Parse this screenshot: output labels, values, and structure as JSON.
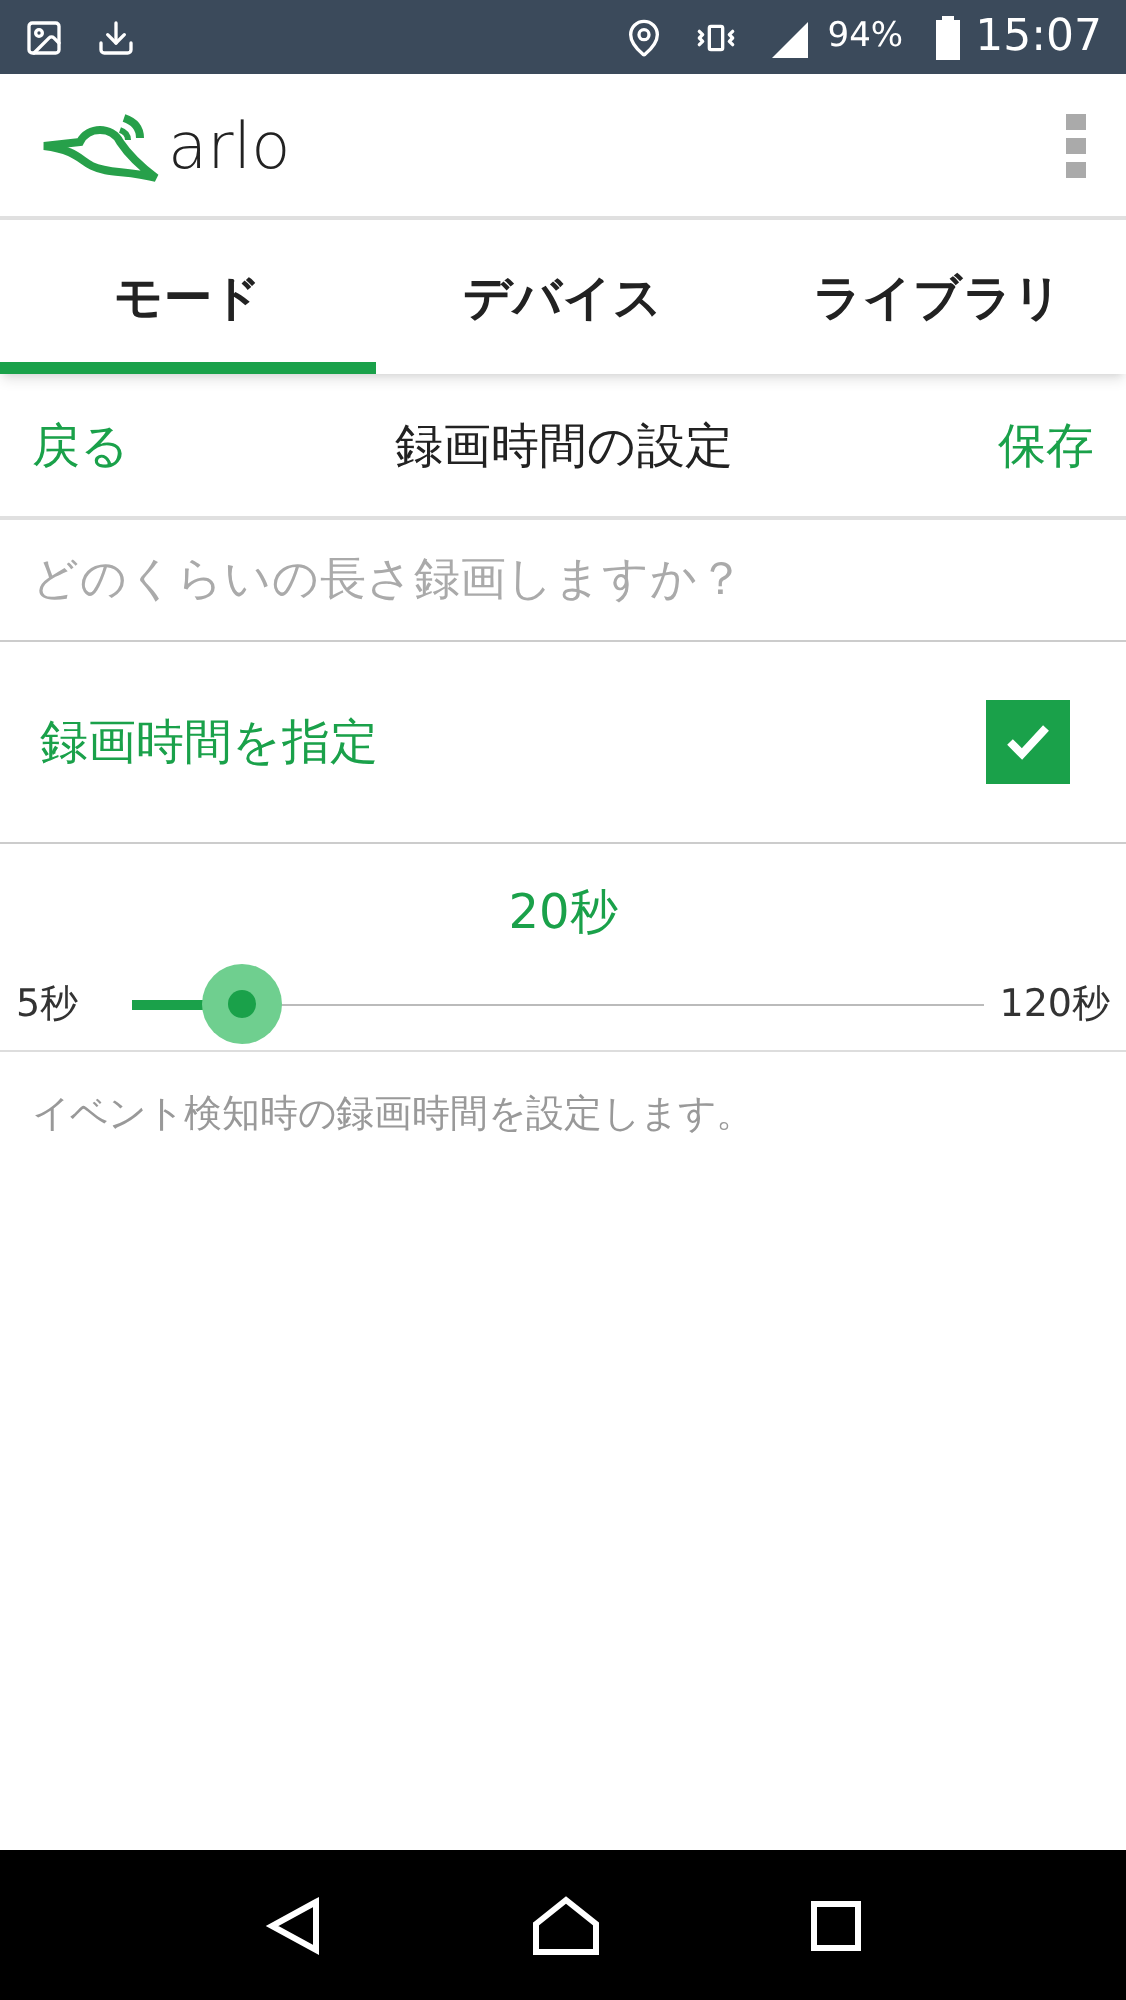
{
  "status_bar": {
    "battery": "94%",
    "time": "15:07"
  },
  "app_bar": {
    "logo": "arlo"
  },
  "tabs": [
    {
      "label": "モード",
      "selected": true
    },
    {
      "label": "デバイス",
      "selected": false
    },
    {
      "label": "ライブラリ",
      "selected": false
    }
  ],
  "toolbar": {
    "back": "戻る",
    "title": "録画時間の設定",
    "save": "保存"
  },
  "question": "どのくらいの長さ録画しますか？",
  "option": {
    "label": "録画時間を指定",
    "checked": true
  },
  "slider": {
    "value": "20秒",
    "min": "5秒",
    "max": "120秒",
    "level": 0.13
  },
  "description": "イベント検知時の録画時間を設定します。"
}
